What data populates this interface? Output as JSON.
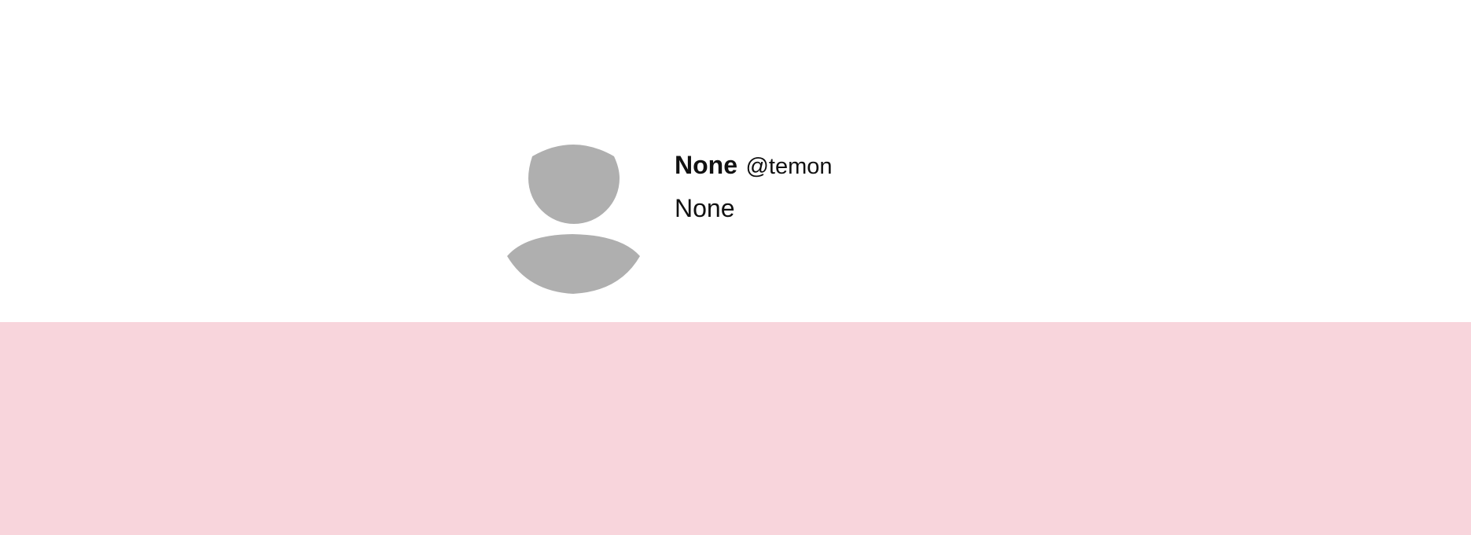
{
  "profile": {
    "display_name": "None",
    "handle": "@temon",
    "bio": "None",
    "avatar_icon": "default-user-avatar-icon",
    "avatar_color": "#afafaf"
  },
  "colors": {
    "header_background": "#ffffff",
    "content_background": "#f8d5dc",
    "text": "#111111"
  }
}
